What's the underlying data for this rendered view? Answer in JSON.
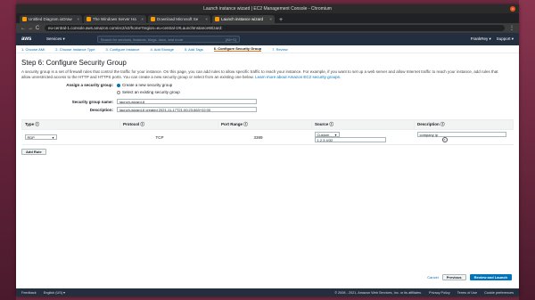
{
  "window": {
    "title": "Launch instance wizard | EC2 Management Console - Chromium",
    "close": "×"
  },
  "tabs": [
    {
      "label": "Untitled Diagram.ioDraw",
      "close": "×"
    },
    {
      "label": "The Windows Server Ha",
      "close": "×"
    },
    {
      "label": "Download Microsoft Se",
      "close": "×"
    },
    {
      "label": "Launch instance wizard",
      "close": "×"
    }
  ],
  "newtab": "+",
  "address": {
    "back": "←",
    "forward": "→",
    "reload": "C",
    "url": "eu-central-1.console.aws.amazon.com/ec2/v2/home?region=eu-central-1#LaunchInstanceWizard:",
    "menu": "⋮"
  },
  "aws": {
    "logo": "aws",
    "services": "Services ▾",
    "search_placeholder": "Search for services, features, blogs, docs, and more",
    "search_shortcut": "[Alt+S]",
    "account": "FrankRey ▾",
    "support": "Support ▾"
  },
  "steps": [
    "1. Choose AMI",
    "2. Choose Instance Type",
    "3. Configure Instance",
    "4. Add Storage",
    "5. Add Tags",
    "6. Configure Security Group",
    "7. Review"
  ],
  "page": {
    "title": "Step 6: Configure Security Group",
    "desc": "A security group is a set of firewall rules that control the traffic for your instance. On this page, you can add rules to allow specific traffic to reach your instance. For example, if you want to set up a web server and allow Internet traffic to reach your instance, add rules that allow unrestricted access to the HTTP and HTTPS ports. You can create a new security group or select from an existing one below.",
    "learn_more": "Learn more about Amazon EC2 security groups."
  },
  "assign": {
    "label": "Assign a security group:",
    "opt_new": "Create a new security group",
    "opt_existing": "Select an existing security group"
  },
  "group": {
    "name_label": "Security group name:",
    "name_value": "launch-wizard-6",
    "desc_label": "Description:",
    "desc_value": "launch-wizard-6 created 2021-11-17T21:00:23.663+02:00"
  },
  "table": {
    "headers": [
      "Type",
      "Protocol",
      "Port Range",
      "Source",
      "Description"
    ],
    "info": "ⓘ",
    "row": {
      "type": "RDP",
      "protocol": "TCP",
      "port": "3389",
      "source_type": "Custom",
      "source": "1.2.3.4/32",
      "description": "company ip",
      "remove": "×"
    }
  },
  "add_rule": "Add Rule",
  "actions": {
    "cancel": "Cancel",
    "previous": "Previous",
    "review": "Review and Launch"
  },
  "footer": {
    "feedback": "Feedback",
    "language": "English (US) ▾",
    "copyright": "© 2008 - 2021, Amazon Web Services, Inc. or its affiliates.",
    "privacy": "Privacy Policy",
    "terms": "Terms of Use",
    "cookies": "Cookie preferences"
  }
}
